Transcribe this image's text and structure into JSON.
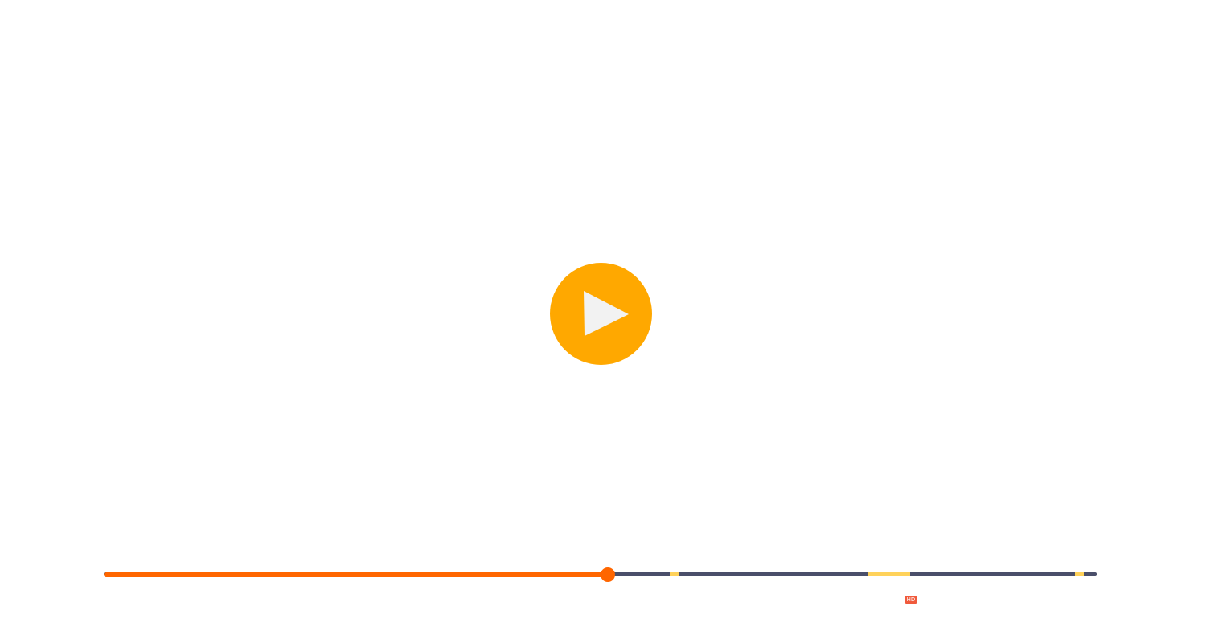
{
  "player": {
    "play_icon": "play-icon",
    "play_color": "#ffa800",
    "progress": {
      "played_fraction": 0.508,
      "played_color": "#ff6600",
      "track_color": "#4a4f6a",
      "marker_color": "#ffd25a",
      "markers": [
        {
          "start": 0.57,
          "end": 0.579
        },
        {
          "start": 0.769,
          "end": 0.812
        },
        {
          "start": 0.978,
          "end": 0.987
        }
      ]
    },
    "quality_badge": {
      "label": "HD",
      "color": "#f05a3c"
    }
  }
}
